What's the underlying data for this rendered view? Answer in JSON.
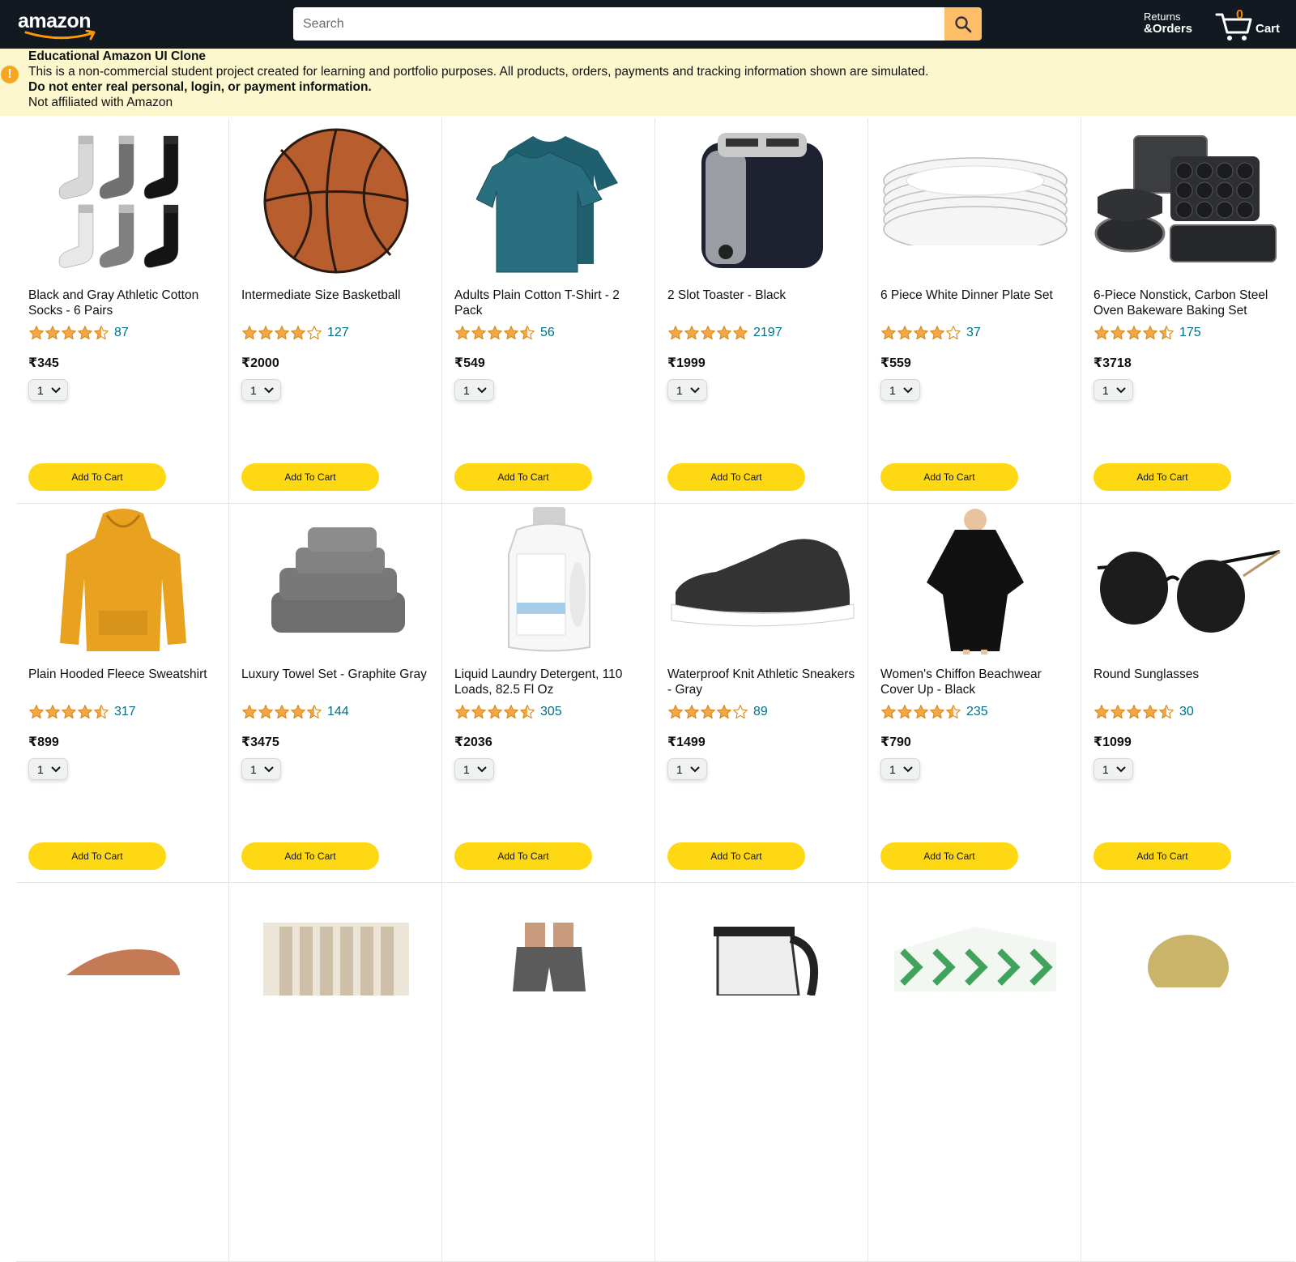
{
  "header": {
    "logo_text": "amazon",
    "search_placeholder": "Search",
    "returns_line1": "Returns",
    "returns_line2": "&Orders",
    "cart_count": "0",
    "cart_label": "Cart"
  },
  "notice": {
    "title": "Educational Amazon UI Clone",
    "line1": "This is a non-commercial student project created for learning and portfolio purposes. All products, orders, payments and tracking information shown are simulated.",
    "line2": "Do not enter real personal, login, or payment information.",
    "line3": "Not affiliated with Amazon"
  },
  "add_to_cart_label": "Add To Cart",
  "products": [
    {
      "name": "Black and Gray Athletic Cotton Socks - 6 Pairs",
      "rating": 4.5,
      "count": "87",
      "price": "₹345",
      "qty": "1",
      "image": "socks"
    },
    {
      "name": "Intermediate Size Basketball",
      "rating": 4.0,
      "count": "127",
      "price": "₹2000",
      "qty": "1",
      "image": "basketball"
    },
    {
      "name": "Adults Plain Cotton T-Shirt - 2 Pack",
      "rating": 4.5,
      "count": "56",
      "price": "₹549",
      "qty": "1",
      "image": "tshirt"
    },
    {
      "name": "2 Slot Toaster - Black",
      "rating": 5.0,
      "count": "2197",
      "price": "₹1999",
      "qty": "1",
      "image": "toaster"
    },
    {
      "name": "6 Piece White Dinner Plate Set",
      "rating": 4.0,
      "count": "37",
      "price": "₹559",
      "qty": "1",
      "image": "plates"
    },
    {
      "name": "6-Piece Nonstick, Carbon Steel Oven Bakeware Baking Set",
      "rating": 4.5,
      "count": "175",
      "price": "₹3718",
      "qty": "1",
      "image": "bakeware"
    },
    {
      "name": "Plain Hooded Fleece Sweatshirt",
      "rating": 4.5,
      "count": "317",
      "price": "₹899",
      "qty": "1",
      "image": "hoodie"
    },
    {
      "name": "Luxury Towel Set - Graphite Gray",
      "rating": 4.5,
      "count": "144",
      "price": "₹3475",
      "qty": "1",
      "image": "towels"
    },
    {
      "name": "Liquid Laundry Detergent, 110 Loads, 82.5 Fl Oz",
      "rating": 4.5,
      "count": "305",
      "price": "₹2036",
      "qty": "1",
      "image": "detergent"
    },
    {
      "name": "Waterproof Knit Athletic Sneakers - Gray",
      "rating": 4.0,
      "count": "89",
      "price": "₹1499",
      "qty": "1",
      "image": "sneaker"
    },
    {
      "name": "Women's Chiffon Beachwear Cover Up - Black",
      "rating": 4.5,
      "count": "235",
      "price": "₹790",
      "qty": "1",
      "image": "coverup"
    },
    {
      "name": "Round Sunglasses",
      "rating": 4.5,
      "count": "30",
      "price": "₹1099",
      "qty": "1",
      "image": "sunglasses"
    },
    {
      "name": "",
      "rating": null,
      "count": "",
      "price": "",
      "qty": "",
      "image": "sandal"
    },
    {
      "name": "",
      "rating": null,
      "count": "",
      "price": "",
      "qty": "",
      "image": "curtains"
    },
    {
      "name": "",
      "rating": null,
      "count": "",
      "price": "",
      "qty": "",
      "image": "shorts"
    },
    {
      "name": "",
      "rating": null,
      "count": "",
      "price": "",
      "qty": "",
      "image": "kettle"
    },
    {
      "name": "",
      "rating": null,
      "count": "",
      "price": "",
      "qty": "",
      "image": "tissue-box"
    },
    {
      "name": "",
      "rating": null,
      "count": "",
      "price": "",
      "qty": "",
      "image": "straw-hat"
    }
  ],
  "colors": {
    "header_bg": "#131921",
    "accent": "#febd69",
    "button": "#ffd814",
    "link": "#007185",
    "star": "#f3a847",
    "notice_bg": "#fdf7ce"
  }
}
